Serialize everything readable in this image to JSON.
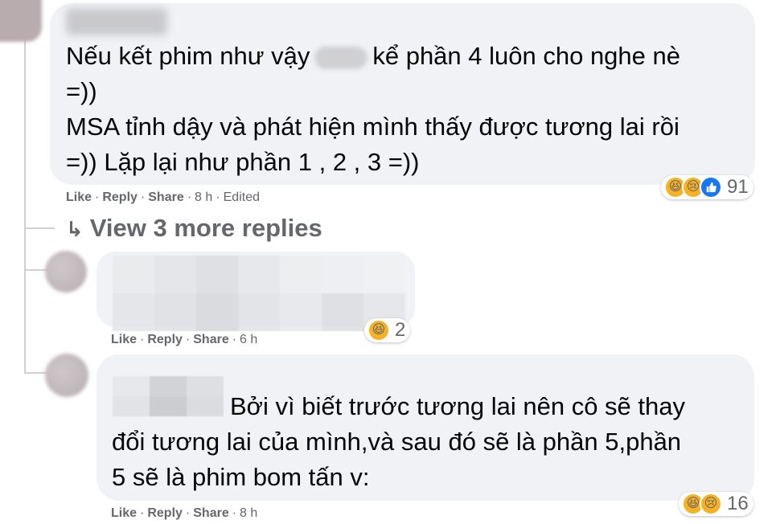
{
  "comments": [
    {
      "text_before": "Nếu kết phim như vậy",
      "text_after": "kể phần 4 luôn cho nghe nè",
      "text_line2": "=))",
      "text_line3": "MSA tỉnh dậy và phát hiện mình thấy được tương lai rồi",
      "text_line4": "=)) Lặp lại như phần 1 , 2 , 3 =))",
      "actions": {
        "like": "Like",
        "reply": "Reply",
        "share": "Share",
        "time": "8 h",
        "edited": "Edited"
      },
      "reaction_icons": [
        "haha-icon",
        "sad-icon",
        "like-icon"
      ],
      "reaction_count": "91"
    },
    {
      "actions": {
        "like": "Like",
        "reply": "Reply",
        "share": "Share",
        "time": "6 h"
      },
      "reaction_icons": [
        "haha-icon"
      ],
      "reaction_count": "2"
    },
    {
      "text_line1": "Bởi vì biết trước tương lai nên cô sẽ thay",
      "text_line2": "đổi tương lai của mình,và sau đó sẽ là phần 5,phần",
      "text_line3": "5 sẽ là phim bom tấn v:",
      "actions": {
        "like": "Like",
        "reply": "Reply",
        "share": "Share",
        "time": "8 h"
      },
      "reaction_icons": [
        "haha-icon",
        "sad-icon"
      ],
      "reaction_count": "16"
    }
  ],
  "view_more": {
    "arrow": "↳",
    "label": "View 3 more replies"
  },
  "colors": {
    "bubble": "#f0f2f5",
    "meta_text": "#65676b",
    "thread_line": "#ced0d4"
  }
}
